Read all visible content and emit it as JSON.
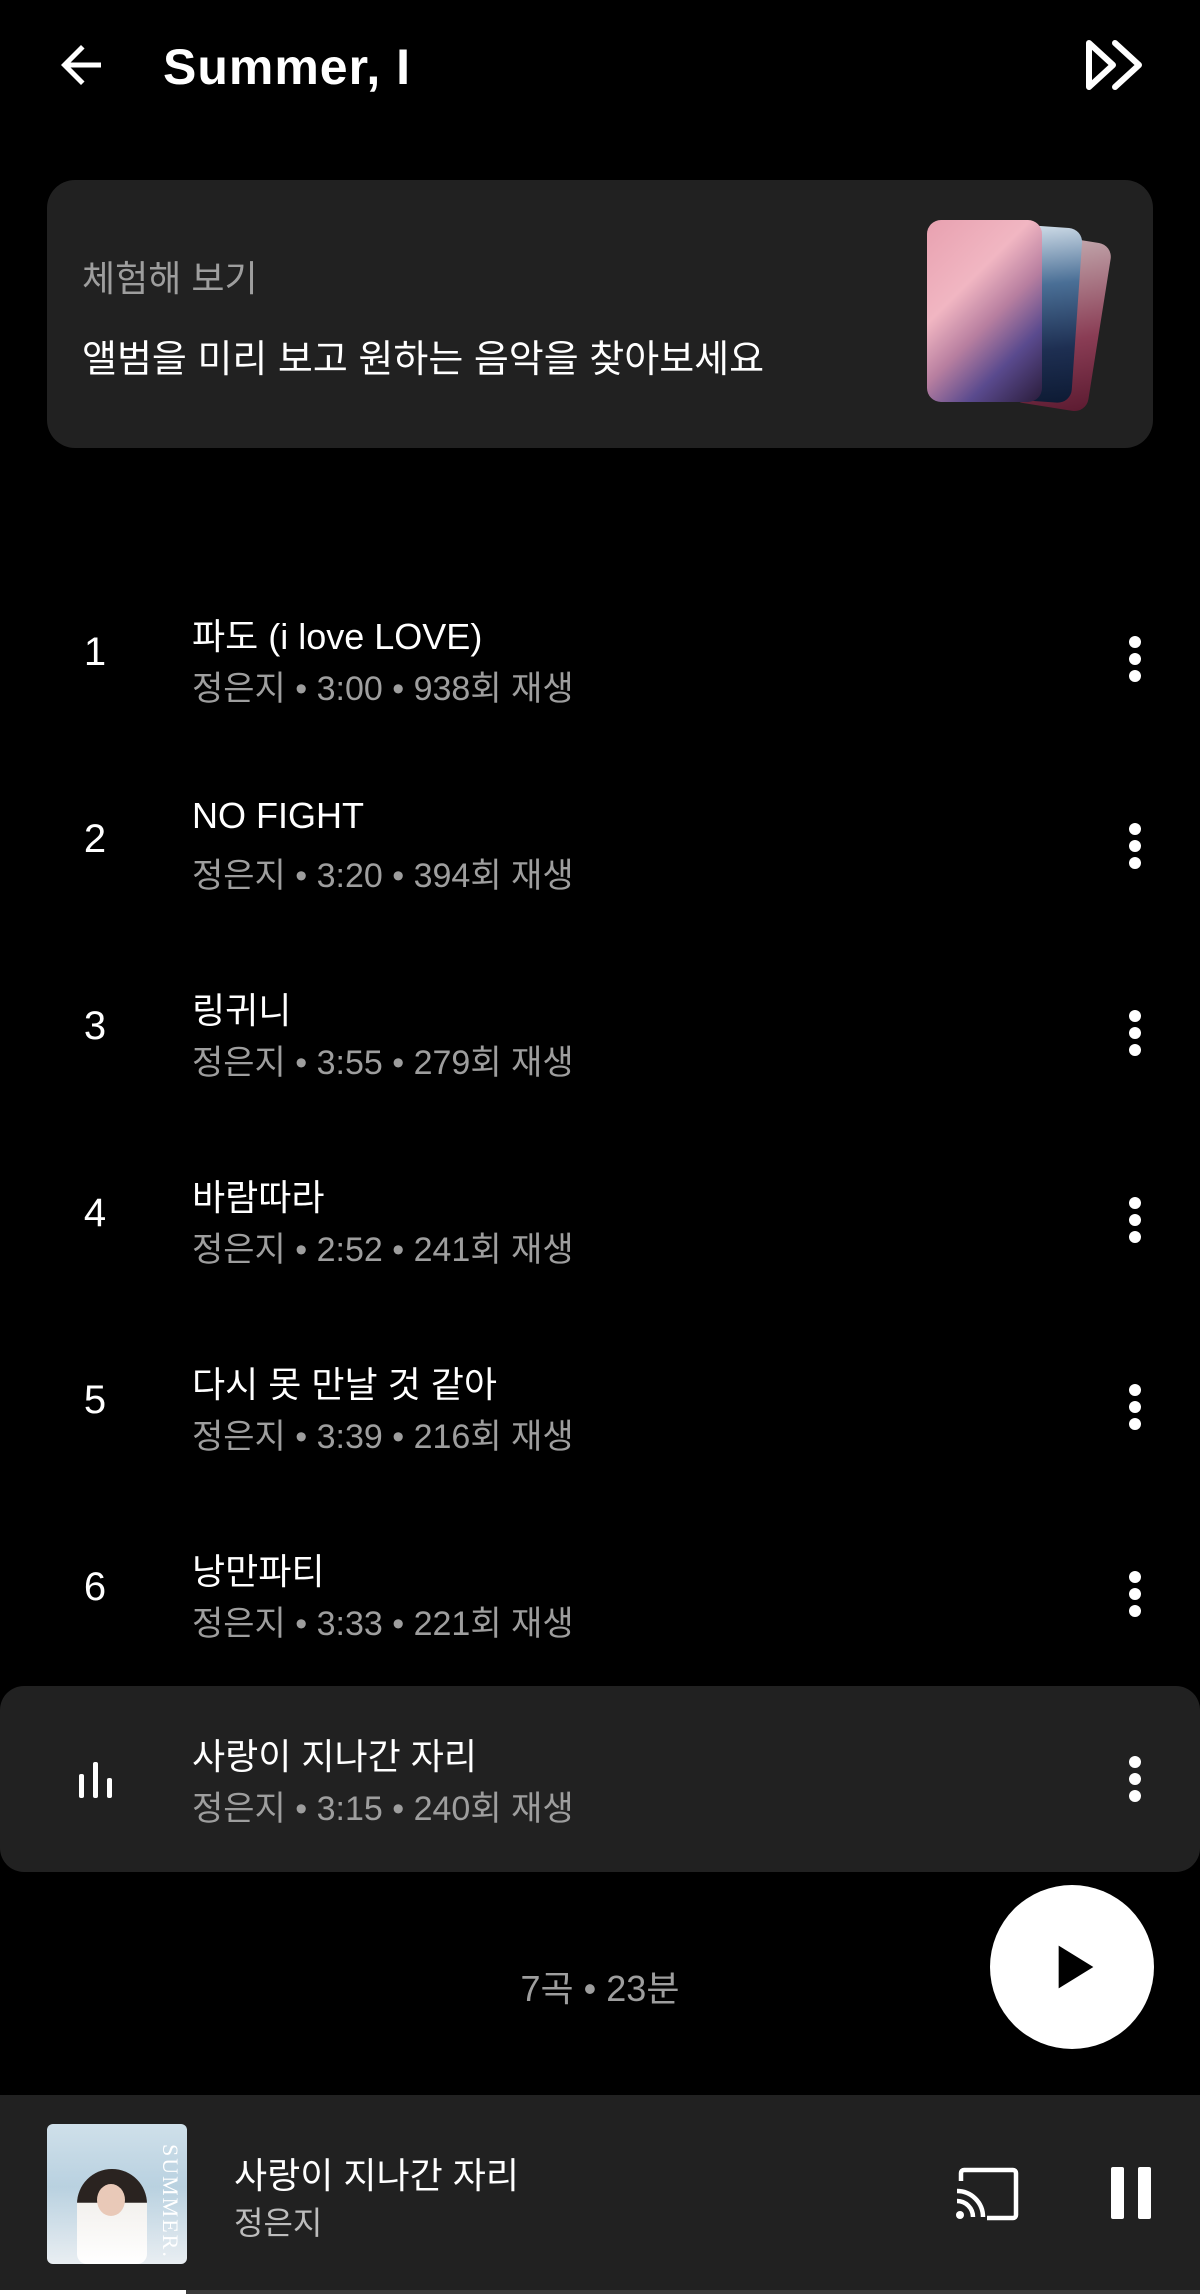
{
  "header": {
    "title": "Summer, I"
  },
  "preview": {
    "subtitle": "체험해 보기",
    "text": "앨범을 미리 보고 원하는 음악을 찾아보세요"
  },
  "tracks": [
    {
      "num": "1",
      "title": "파도 (i love LOVE)",
      "meta": "정은지 • 3:00 • 938회 재생"
    },
    {
      "num": "2",
      "title": "NO FIGHT",
      "meta": "정은지 • 3:20 • 394회 재생"
    },
    {
      "num": "3",
      "title": "링귀니",
      "meta": "정은지 • 3:55 • 279회 재생"
    },
    {
      "num": "4",
      "title": "바람따라",
      "meta": "정은지 • 2:52 • 241회 재생"
    },
    {
      "num": "5",
      "title": "다시 못 만날 것 같아",
      "meta": "정은지 • 3:39 • 216회 재생"
    },
    {
      "num": "6",
      "title": "낭만파티",
      "meta": "정은지 • 3:33 • 221회 재생"
    },
    {
      "num": "",
      "title": "사랑이 지나간 자리",
      "meta": "정은지 • 3:15 • 240회 재생",
      "playing": true
    }
  ],
  "summary": "7곡 • 23분",
  "mini_player": {
    "title": "사랑이 지나간 자리",
    "artist": "정은지",
    "art_text": "SUMMER.",
    "progress": 0.155
  },
  "icons": {
    "back": "arrow-left-icon",
    "play_all_next": "fast-forward-icon",
    "more": "more-vert-icon",
    "now_playing": "equalizer-icon",
    "play": "play-icon",
    "cast": "cast-icon",
    "pause": "pause-icon"
  },
  "colors": {
    "background": "#000000",
    "surface": "#212121",
    "secondary_text": "#9e9e9e",
    "primary_text": "#ffffff"
  }
}
